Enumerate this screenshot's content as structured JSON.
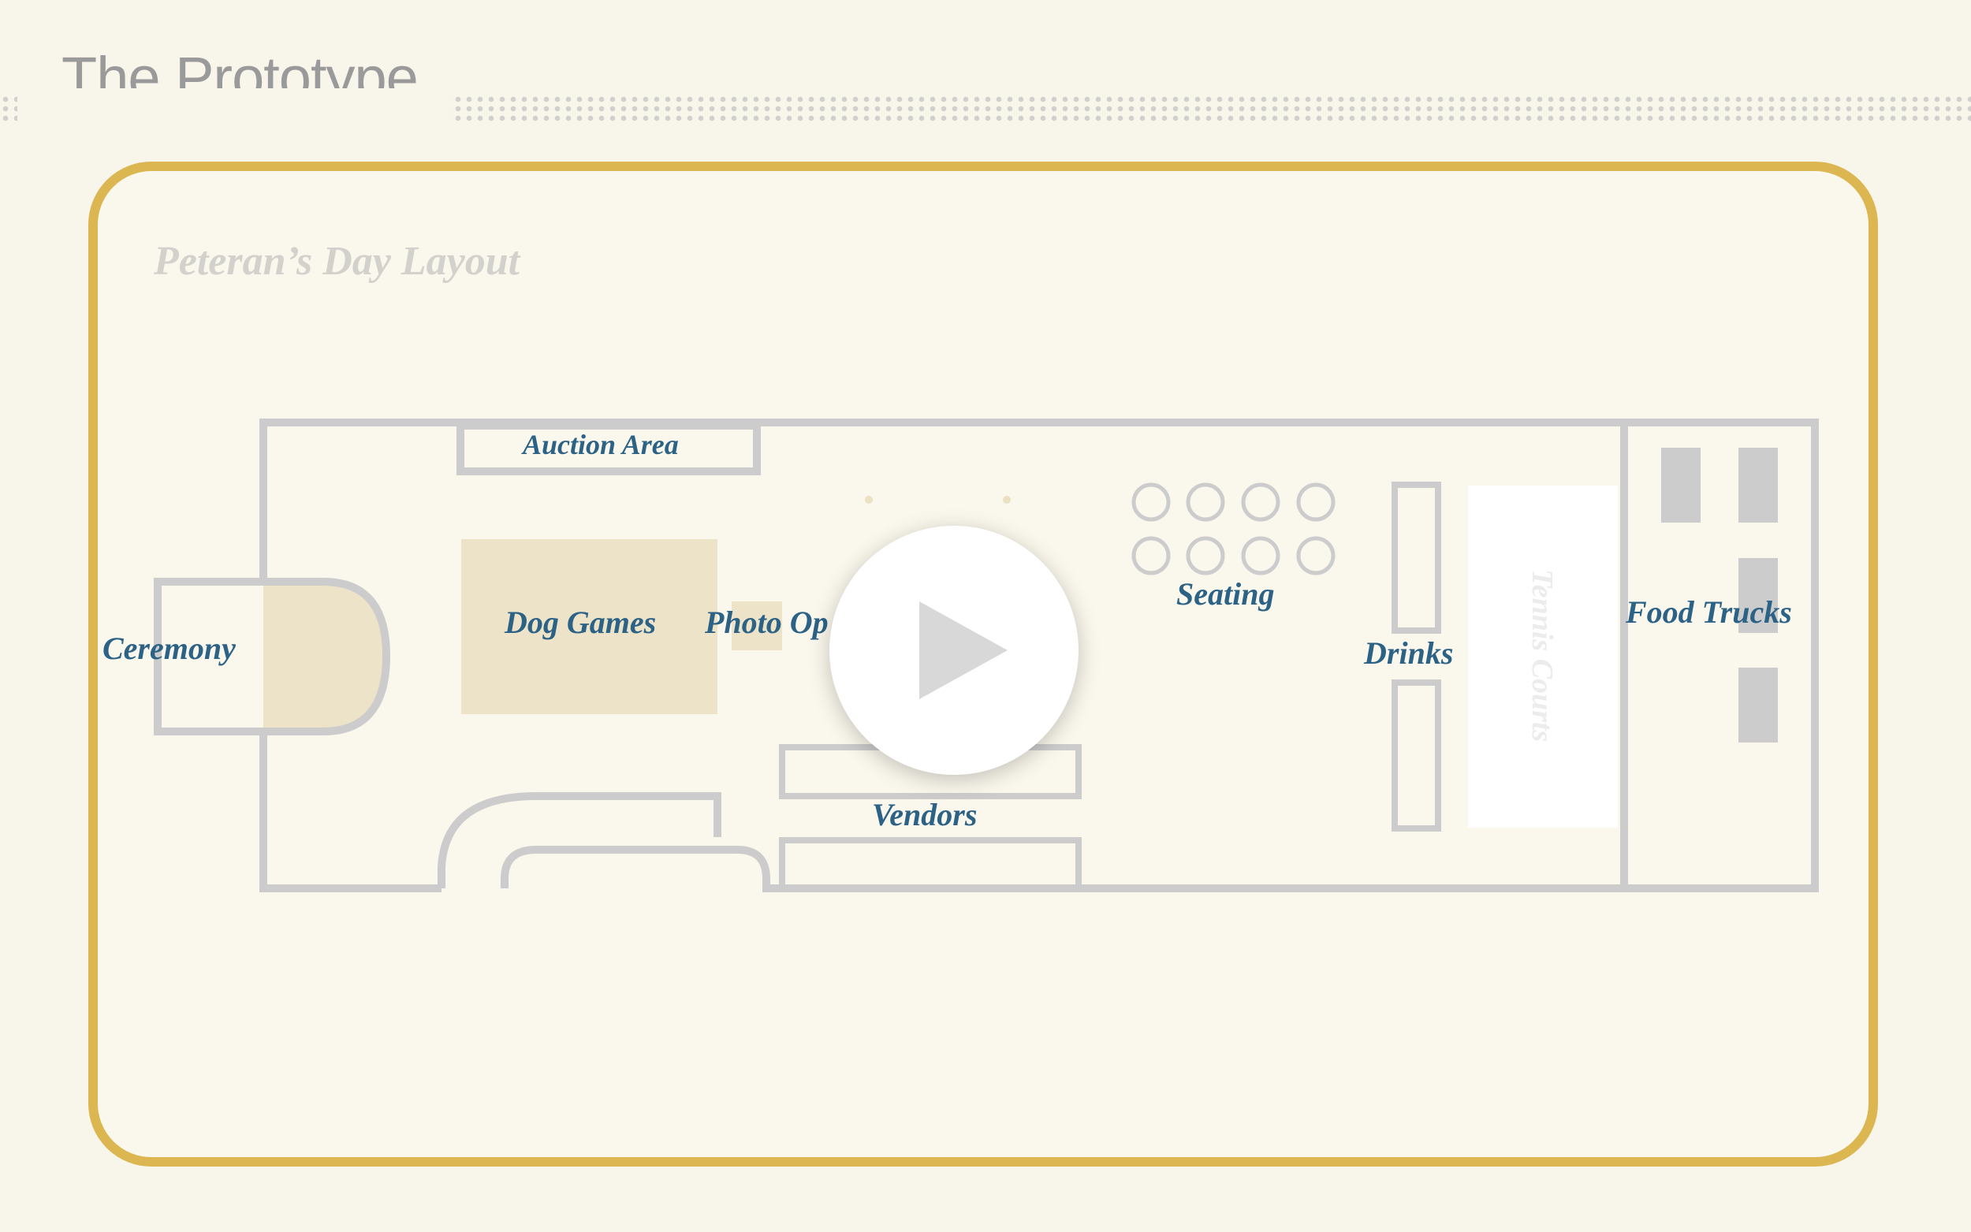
{
  "slide": {
    "title": "The Prototype"
  },
  "layout_diagram": {
    "title": "Peteran’s Day Layout",
    "areas": {
      "ceremony": "Ceremony",
      "dog_games": "Dog Games",
      "photo_op": "Photo Op",
      "auction_area": "Auction Area",
      "seating": "Seating",
      "drinks": "Drinks",
      "tennis_courts": "Tennis Courts",
      "food_trucks": "Food Trucks",
      "vendors": "Vendors"
    }
  },
  "video": {
    "play_icon": "play-icon"
  },
  "colors": {
    "frame_border": "#dbb651",
    "label_blue": "#2c6286",
    "wall_gray": "#cccccc",
    "zone_tan": "#ede3c8",
    "background": "#f8f5ea"
  }
}
